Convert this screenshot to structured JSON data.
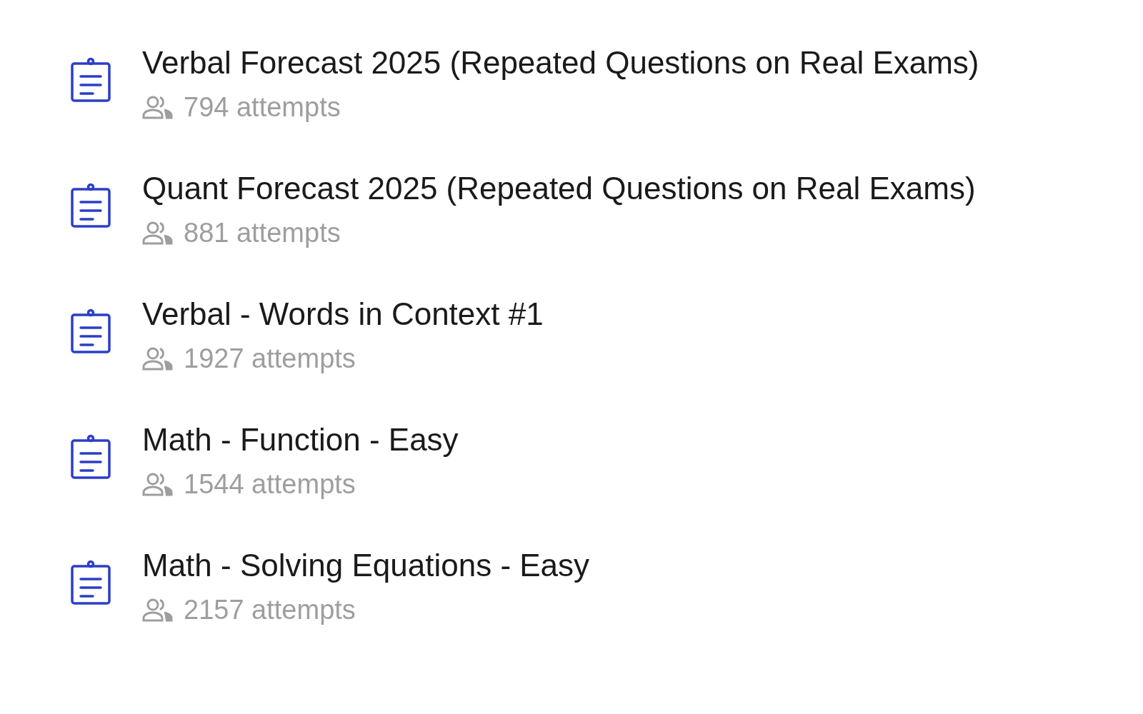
{
  "quizzes": [
    {
      "title": "Verbal Forecast 2025 (Repeated Questions on Real Exams)",
      "attempts": "794 attempts"
    },
    {
      "title": "Quant Forecast 2025 (Repeated Questions on Real Exams)",
      "attempts": "881 attempts"
    },
    {
      "title": "Verbal - Words in Context #1",
      "attempts": "1927 attempts"
    },
    {
      "title": "Math - Function - Easy",
      "attempts": "1544 attempts"
    },
    {
      "title": "Math - Solving Equations - Easy",
      "attempts": "2157 attempts"
    }
  ]
}
